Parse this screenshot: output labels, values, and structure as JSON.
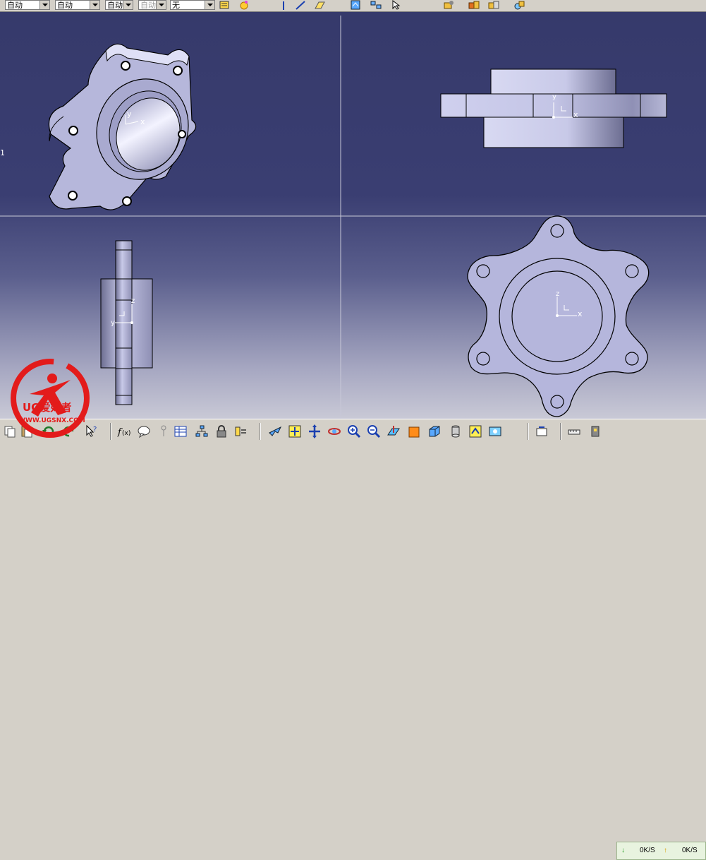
{
  "toolbar": {
    "combo_1": "自动",
    "combo_2": "自动",
    "combo_3": "自动",
    "combo_4": "自动",
    "combo_5": "无"
  },
  "viewport": {
    "background_top": "#363a6b",
    "background_bottom": "#c9c9d6",
    "part_fill": "#b7b8dc",
    "axes": {
      "iso": [
        "y",
        "x"
      ],
      "front": [
        "y",
        "x"
      ],
      "side": [
        "z",
        "y"
      ],
      "top": [
        "z",
        "x"
      ]
    },
    "left_edge_label": "1"
  },
  "network": {
    "download": "0K/S",
    "upload": "0K/S"
  },
  "watermark": {
    "brand": "UG爱好者",
    "url": "WWW.UGSNX.COM"
  }
}
